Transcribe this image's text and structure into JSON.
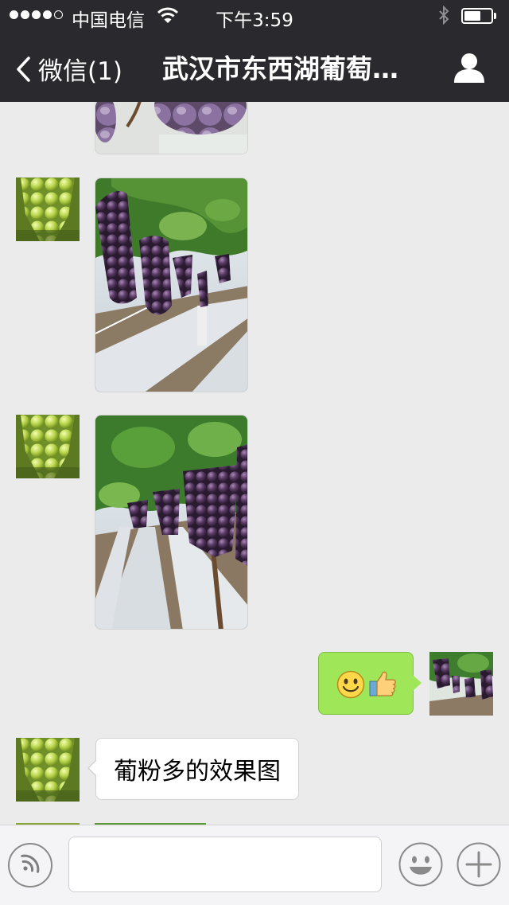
{
  "status_bar": {
    "carrier": "中国电信",
    "time": "下午3:59",
    "signal_bars_filled": 4,
    "signal_bars_total": 5
  },
  "nav": {
    "back_label": "微信(1)",
    "title": "武汉市东西湖葡萄…",
    "icons": {
      "back": "chevron-left-icon",
      "contact": "person-icon"
    }
  },
  "messages": [
    {
      "direction": "incoming",
      "type": "image",
      "subject": "grape-cluster",
      "partially_visible": true
    },
    {
      "direction": "incoming",
      "type": "image",
      "subject": "vineyard-grapes"
    },
    {
      "direction": "incoming",
      "type": "image",
      "subject": "vineyard-grapes"
    },
    {
      "direction": "outgoing",
      "type": "emoji",
      "icons": [
        "smile-emoji-icon",
        "thumbs-up-emoji-icon"
      ]
    },
    {
      "direction": "incoming",
      "type": "text",
      "text": "葡粉多的效果图"
    }
  ],
  "input_bar": {
    "placeholder": "",
    "icons": {
      "voice": "voice-icon",
      "emoji": "emoji-icon",
      "more": "plus-icon"
    }
  },
  "colors": {
    "nav_background": "#2a2a2e",
    "chat_background": "#ebebeb",
    "outgoing_bubble": "#9fe658",
    "incoming_bubble": "#ffffff"
  }
}
